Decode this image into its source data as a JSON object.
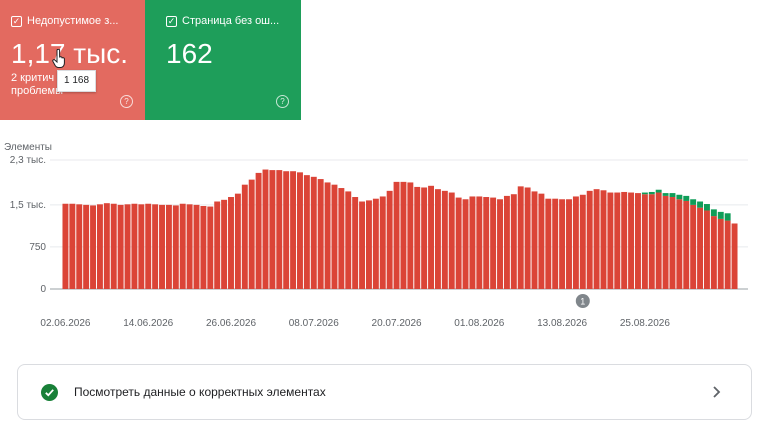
{
  "cards": {
    "invalid": {
      "title": "Недопустимое з...",
      "value": "1,17 тыс.",
      "subtext": "2 критич проблемы",
      "tooltip": "1 168",
      "color": "#e36a60"
    },
    "valid": {
      "title": "Страница без ош...",
      "value": "162",
      "color": "#1e9e5a"
    }
  },
  "footer": {
    "label": "Посмотреть данные о корректных элементах"
  },
  "chart_data": {
    "type": "bar",
    "ylabel": "Элементы",
    "y_ticks": [
      "0",
      "750",
      "1,5 тыс.",
      "2,3 тыс."
    ],
    "y_tick_values": [
      0,
      750,
      1500,
      2300
    ],
    "ylim": [
      0,
      2300
    ],
    "x_tick_labels": [
      "02.06.2026",
      "14.06.2026",
      "26.06.2026",
      "08.07.2026",
      "20.07.2026",
      "01.08.2026",
      "13.08.2026",
      "25.08.2026"
    ],
    "x_tick_indices": [
      0,
      12,
      24,
      36,
      48,
      60,
      72,
      84
    ],
    "annotation": {
      "label": "1",
      "index": 75
    },
    "series": [
      {
        "color": "#db4437",
        "values": [
          1520,
          1520,
          1510,
          1500,
          1490,
          1510,
          1530,
          1520,
          1500,
          1510,
          1520,
          1510,
          1520,
          1510,
          1500,
          1500,
          1490,
          1520,
          1510,
          1500,
          1480,
          1470,
          1560,
          1590,
          1640,
          1700,
          1860,
          1950,
          2070,
          2130,
          2120,
          2120,
          2100,
          2100,
          2080,
          2030,
          2000,
          1960,
          1900,
          1860,
          1800,
          1740,
          1640,
          1560,
          1580,
          1610,
          1650,
          1750,
          1910,
          1910,
          1900,
          1820,
          1810,
          1840,
          1780,
          1750,
          1720,
          1630,
          1600,
          1650,
          1650,
          1640,
          1630,
          1600,
          1660,
          1690,
          1830,
          1810,
          1740,
          1700,
          1610,
          1610,
          1600,
          1600,
          1650,
          1680,
          1750,
          1780,
          1760,
          1720,
          1720,
          1730,
          1720,
          1710,
          1690,
          1690,
          1720,
          1660,
          1640,
          1600,
          1570,
          1500,
          1450,
          1400,
          1300,
          1250,
          1220,
          1168
        ]
      },
      {
        "color": "#0f9d58",
        "values": [
          0,
          0,
          0,
          0,
          0,
          0,
          0,
          0,
          0,
          0,
          0,
          0,
          0,
          0,
          0,
          0,
          0,
          0,
          0,
          0,
          0,
          0,
          0,
          0,
          0,
          0,
          0,
          0,
          0,
          0,
          0,
          0,
          0,
          0,
          0,
          0,
          0,
          0,
          0,
          0,
          0,
          0,
          0,
          0,
          0,
          0,
          0,
          0,
          0,
          0,
          0,
          0,
          0,
          0,
          0,
          0,
          0,
          0,
          0,
          0,
          0,
          0,
          0,
          0,
          0,
          0,
          0,
          0,
          0,
          0,
          0,
          0,
          0,
          0,
          0,
          0,
          0,
          0,
          0,
          0,
          0,
          0,
          0,
          0,
          30,
          40,
          50,
          50,
          70,
          80,
          90,
          100,
          110,
          115,
          120,
          125,
          130,
          0
        ]
      }
    ]
  }
}
